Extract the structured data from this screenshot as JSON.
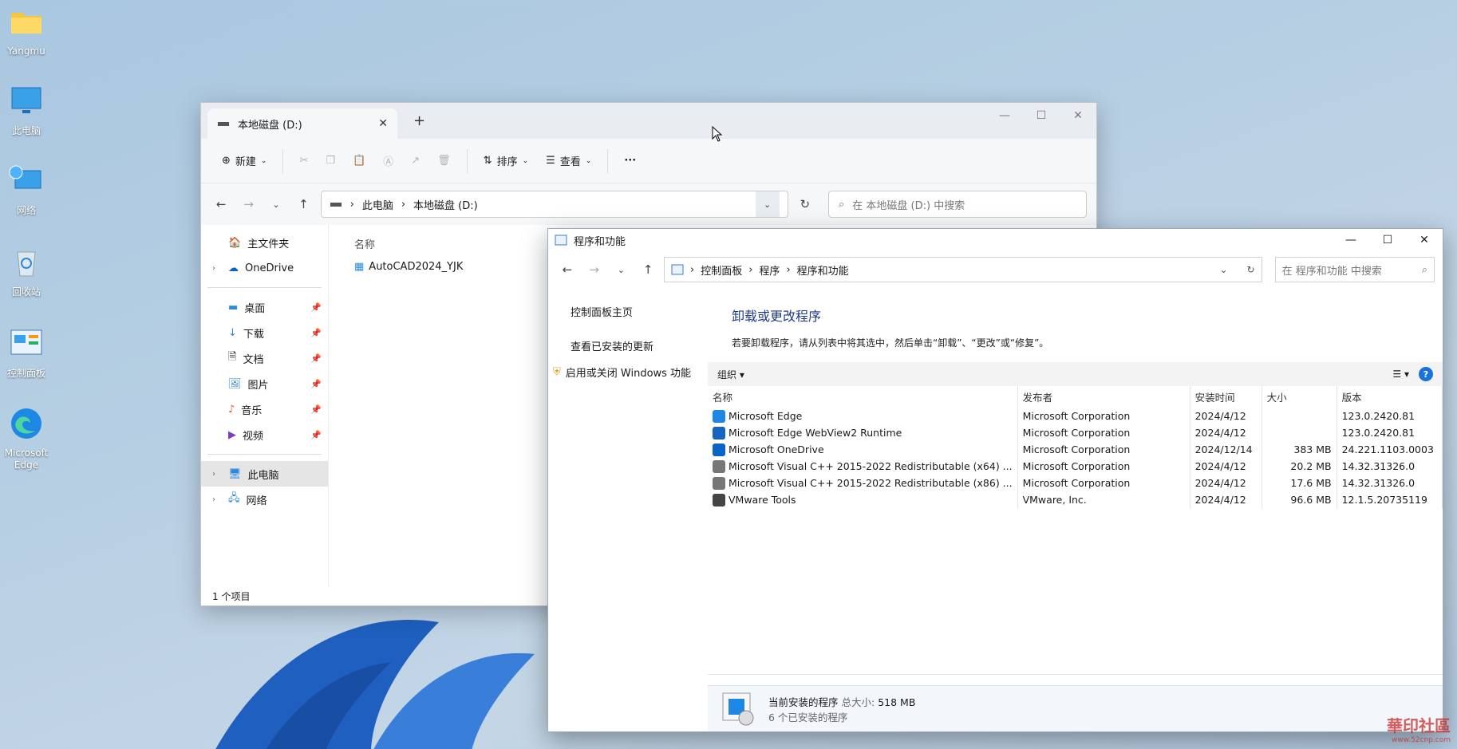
{
  "desktop": {
    "icons": [
      {
        "label": "Yangmu",
        "icon": "folder-icon"
      },
      {
        "label": "此电脑",
        "icon": "monitor-icon"
      },
      {
        "label": "网络",
        "icon": "network-icon"
      },
      {
        "label": "回收站",
        "icon": "recycle-bin-icon"
      },
      {
        "label": "控制面板",
        "icon": "control-panel-icon"
      },
      {
        "label": "Microsoft Edge",
        "icon": "edge-icon"
      }
    ]
  },
  "explorer": {
    "tab_title": "本地磁盘 (D:)",
    "toolbar": {
      "new": "新建",
      "sort": "排序",
      "view": "查看",
      "more": "···"
    },
    "breadcrumb": [
      "此电脑",
      "本地磁盘 (D:)"
    ],
    "search_placeholder": "在 本地磁盘 (D:) 中搜索",
    "nav": {
      "home": "主文件夹",
      "onedrive": "OneDrive",
      "desktop": "桌面",
      "downloads": "下载",
      "documents": "文档",
      "pictures": "图片",
      "music": "音乐",
      "videos": "视频",
      "thispc": "此电脑",
      "network": "网络"
    },
    "column_name": "名称",
    "file": "AutoCAD2024_YJK",
    "status": "1 个项目"
  },
  "programs": {
    "title": "程序和功能",
    "breadcrumb": [
      "控制面板",
      "程序",
      "程序和功能"
    ],
    "search_placeholder": "在 程序和功能 中搜索",
    "left": {
      "home": "控制面板主页",
      "updates": "查看已安装的更新",
      "features": "启用或关闭 Windows 功能"
    },
    "heading": "卸载或更改程序",
    "description": "若要卸载程序，请从列表中将其选中，然后单击“卸载”、“更改”或“修复”。",
    "organize": "组织 ▾",
    "columns": {
      "name": "名称",
      "publisher": "发布者",
      "date": "安装时间",
      "size": "大小",
      "version": "版本"
    },
    "rows": [
      {
        "name": "Microsoft Edge",
        "publisher": "Microsoft Corporation",
        "date": "2024/4/12",
        "size": "",
        "version": "123.0.2420.81",
        "color": "#1e88e5"
      },
      {
        "name": "Microsoft Edge WebView2 Runtime",
        "publisher": "Microsoft Corporation",
        "date": "2024/4/12",
        "size": "",
        "version": "123.0.2420.81",
        "color": "#1565c0"
      },
      {
        "name": "Microsoft OneDrive",
        "publisher": "Microsoft Corporation",
        "date": "2024/12/14",
        "size": "383 MB",
        "version": "24.221.1103.0003",
        "color": "#0a64c8"
      },
      {
        "name": "Microsoft Visual C++ 2015-2022 Redistributable (x64) ...",
        "publisher": "Microsoft Corporation",
        "date": "2024/4/12",
        "size": "20.2 MB",
        "version": "14.32.31326.0",
        "color": "#777"
      },
      {
        "name": "Microsoft Visual C++ 2015-2022 Redistributable (x86) ...",
        "publisher": "Microsoft Corporation",
        "date": "2024/4/12",
        "size": "17.6 MB",
        "version": "14.32.31326.0",
        "color": "#777"
      },
      {
        "name": "VMware Tools",
        "publisher": "VMware, Inc.",
        "date": "2024/4/12",
        "size": "96.6 MB",
        "version": "12.1.5.20735119",
        "color": "#444"
      }
    ],
    "footer": {
      "label": "当前安装的程序",
      "total_label": "总大小:",
      "total": "518 MB",
      "count": "6 个已安装的程序"
    }
  },
  "watermark": {
    "text": "華印社區",
    "url": "www.52cnp.com"
  }
}
